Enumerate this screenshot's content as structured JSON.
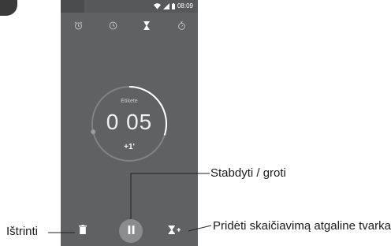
{
  "status_bar": {
    "time": "08:09",
    "icons": [
      "wifi-icon",
      "signal-icon",
      "battery-icon"
    ]
  },
  "tabs": [
    {
      "icon": "alarm-icon",
      "active": false
    },
    {
      "icon": "clock-icon",
      "active": false
    },
    {
      "icon": "hourglass-icon",
      "active": true
    },
    {
      "icon": "stopwatch-icon",
      "active": false
    }
  ],
  "timer": {
    "label": "Etikete",
    "time": "0 05",
    "add_minute": "+1'",
    "progress": 0.3
  },
  "controls": {
    "delete_icon": "trash-icon",
    "pause_icon": "pause-icon",
    "add_timer_icon": "add-timer-icon"
  },
  "callouts": {
    "stop_play": "Stabdyti / groti",
    "delete": "Ištrinti",
    "add_countdown": "Pridėti skaičiavimą atgaline tvarka"
  },
  "colors": {
    "screen_bg": "#5f6162",
    "ring_bg": "#808283",
    "ring_progress": "#ffffff",
    "accent": "#ffffff"
  }
}
